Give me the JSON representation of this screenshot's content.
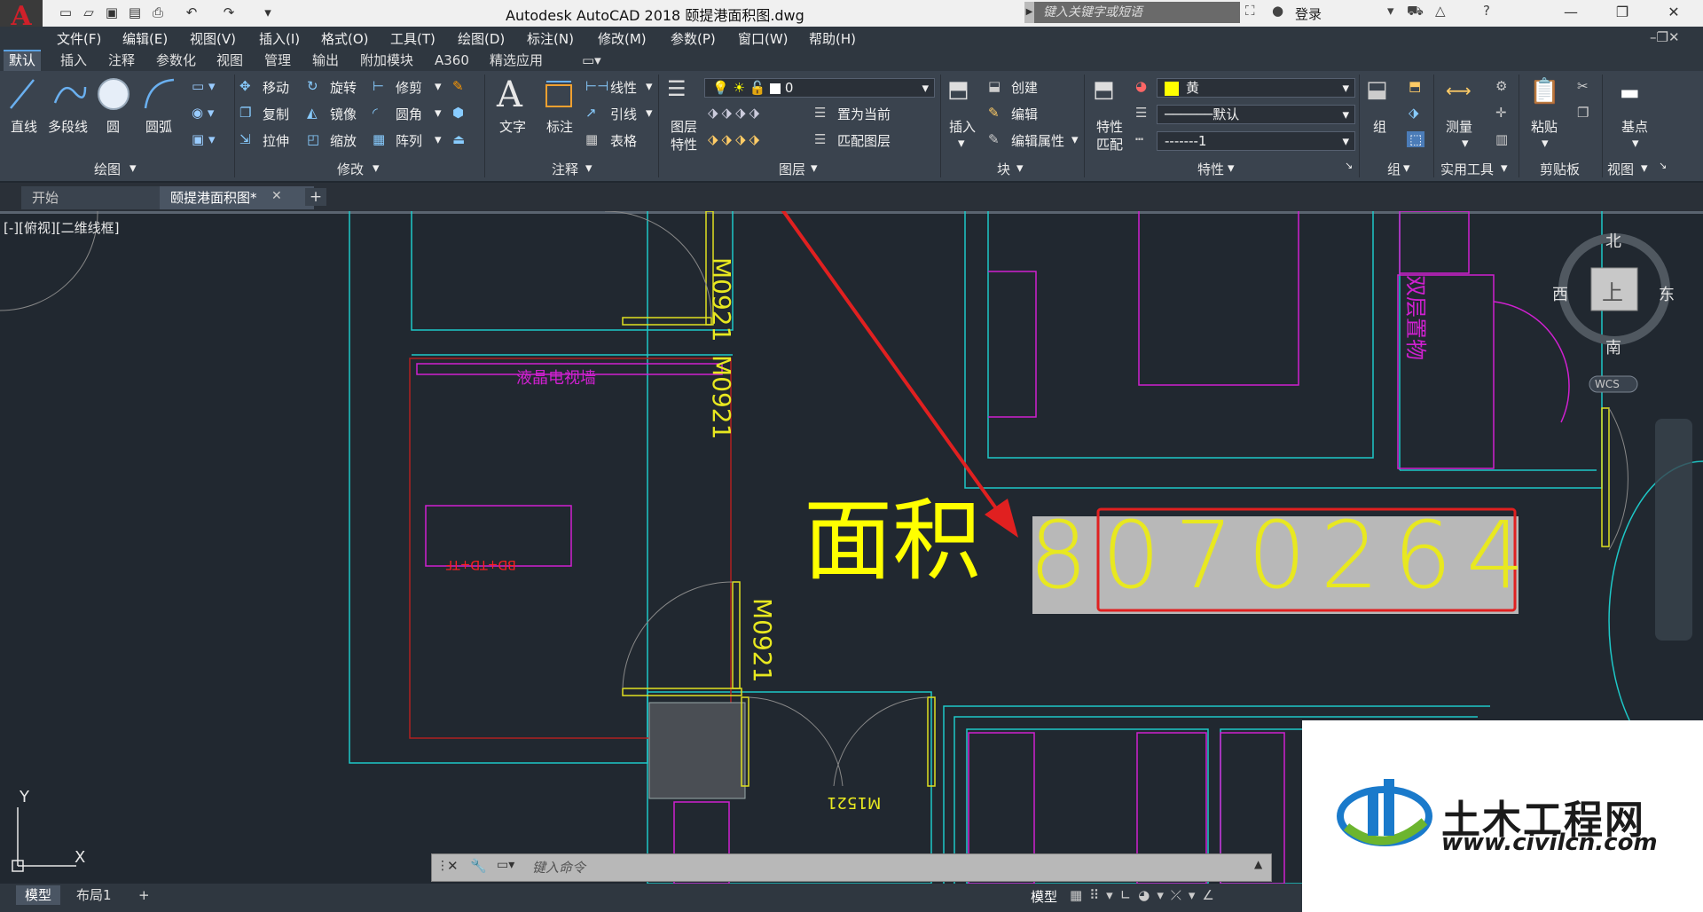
{
  "window": {
    "title": "Autodesk AutoCAD 2018    颐提港面积图.dwg",
    "logo_letter": "A",
    "search_placeholder": "键入关键字或短语",
    "login_label": "登录"
  },
  "menu": [
    "文件(F)",
    "编辑(E)",
    "视图(V)",
    "插入(I)",
    "格式(O)",
    "工具(T)",
    "绘图(D)",
    "标注(N)",
    "修改(M)",
    "参数(P)",
    "窗口(W)",
    "帮助(H)"
  ],
  "ribbon_tabs": [
    "默认",
    "插入",
    "注释",
    "参数化",
    "视图",
    "管理",
    "输出",
    "附加模块",
    "A360",
    "精选应用"
  ],
  "ribbon": {
    "draw": {
      "title": "绘图",
      "line": "直线",
      "polyline": "多段线",
      "circle": "圆",
      "arc": "圆弧"
    },
    "modify": {
      "title": "修改",
      "move": "移动",
      "rotate": "旋转",
      "trim": "修剪",
      "copy": "复制",
      "mirror": "镜像",
      "fillet": "圆角",
      "stretch": "拉伸",
      "scale": "缩放",
      "array": "阵列"
    },
    "annotation": {
      "title": "注释",
      "text": "文字",
      "dimension": "标注",
      "linear": "线性",
      "leader": "引线",
      "table": "表格"
    },
    "layers": {
      "title": "图层",
      "layer_props_1": "图层",
      "layer_props_2": "特性",
      "current_layer": "0",
      "make_current": "置为当前",
      "match_layer": "匹配图层"
    },
    "block": {
      "title": "块",
      "insert": "插入",
      "create": "创建",
      "edit": "编辑",
      "edit_attr": "编辑属性"
    },
    "properties": {
      "title": "特性",
      "match_1": "特性",
      "match_2": "匹配",
      "color": "黄",
      "lineweight": "默认",
      "linetype": "1"
    },
    "groups": {
      "title": "组",
      "group": "组"
    },
    "utilities": {
      "title": "实用工具",
      "measure": "测量"
    },
    "clipboard": {
      "title": "剪贴板",
      "paste": "粘贴"
    },
    "view": {
      "title": "视图",
      "base": "基点"
    }
  },
  "doc_tabs": [
    "开始",
    "颐提港面积图*"
  ],
  "viewport_label": "[-][俯视][二维线框]",
  "drawing": {
    "area_label": "面积",
    "area_value": "8070264",
    "tv_wall": "液晶电视墙",
    "door_tag_1": "M0921",
    "door_tag_2": "M0921",
    "door_tag_3": "M0921",
    "door_tag_4": "M1521",
    "desk_tag": "BD+TD+TF",
    "bath_tag": "双层置物",
    "compass": {
      "north": "北",
      "south": "南",
      "east": "东",
      "west": "西",
      "top": "上",
      "wcs": "WCS"
    },
    "ucs_x": "X",
    "ucs_y": "Y"
  },
  "command": {
    "placeholder": "键入命令"
  },
  "status": {
    "model_tab": "模型",
    "layout_tab": "布局1",
    "model_button": "模型"
  },
  "watermark": {
    "name": "土木工程网",
    "url": "www.civilcn.com"
  },
  "colors": {
    "background": "#212830",
    "ribbon": "#3a434e",
    "yellow": "#ffff00",
    "cyan": "#00ffff",
    "magenta": "#ff00ff",
    "red": "#ff0000",
    "highlight": "#e02020"
  }
}
